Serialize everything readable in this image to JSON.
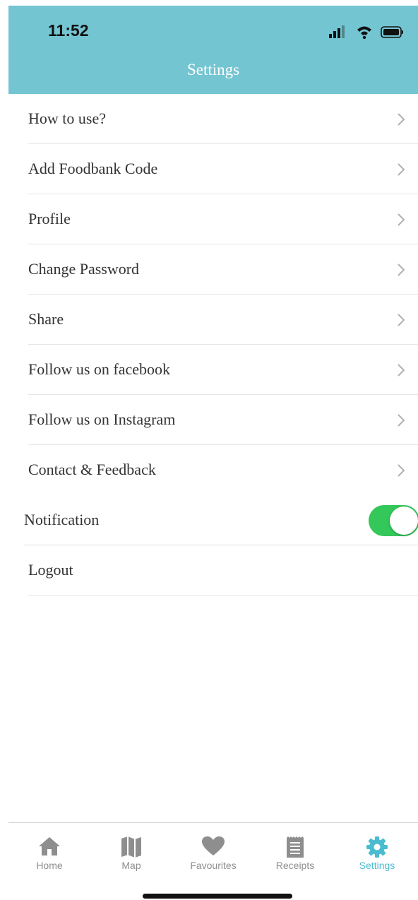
{
  "status_bar": {
    "time": "11:52"
  },
  "header": {
    "title": "Settings"
  },
  "menu": [
    {
      "label": "How to use?"
    },
    {
      "label": "Add Foodbank Code"
    },
    {
      "label": "Profile"
    },
    {
      "label": "Change Password"
    },
    {
      "label": "Share"
    },
    {
      "label": "Follow us on facebook"
    },
    {
      "label": "Follow us on Instagram"
    },
    {
      "label": "Contact & Feedback"
    }
  ],
  "notification": {
    "label": "Notification",
    "enabled": true
  },
  "logout": {
    "label": "Logout"
  },
  "tabs": [
    {
      "label": "Home",
      "icon": "home-icon"
    },
    {
      "label": "Map",
      "icon": "map-icon"
    },
    {
      "label": "Favourites",
      "icon": "heart-icon"
    },
    {
      "label": "Receipts",
      "icon": "receipt-icon"
    },
    {
      "label": "Settings",
      "icon": "gear-icon",
      "active": true
    }
  ],
  "colors": {
    "header": "#74c5d2",
    "active_tab": "#4bbcd0",
    "toggle_on": "#34c759"
  }
}
